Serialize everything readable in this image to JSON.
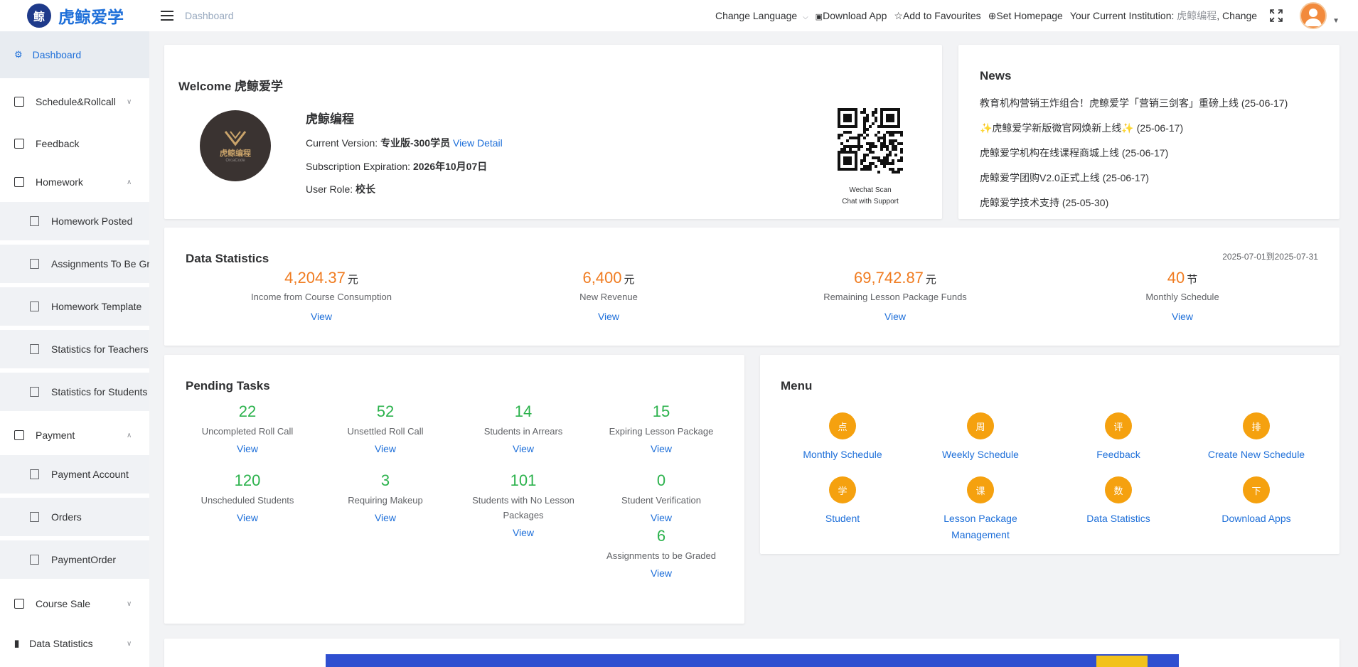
{
  "app": {
    "name": "虎鲸爱学",
    "logo_text": "鲸"
  },
  "header": {
    "breadcrumb": "Dashboard",
    "change_language": "Change Language",
    "download_app": "Download App",
    "add_favourites": "Add to Favourites",
    "set_homepage": "Set Homepage",
    "institution_label": "Your Current Institution:",
    "institution_name": "虎鲸编程",
    "change": ", Change"
  },
  "sidebar": {
    "dashboard": "Dashboard",
    "schedule": "Schedule&Rollcall",
    "feedback": "Feedback",
    "homework": "Homework",
    "homework_posted": "Homework Posted",
    "assignments": "Assignments To Be Graded",
    "homework_template": "Homework Template",
    "stats_teachers": "Statistics for Teachers",
    "stats_students": "Statistics for Students",
    "payment": "Payment",
    "payment_account": "Payment Account",
    "orders": "Orders",
    "payment_order": "PaymentOrder",
    "course_sale": "Course Sale",
    "data_statistics": "Data Statistics"
  },
  "welcome": {
    "title": "Welcome 虎鲸爱学",
    "org_name": "虎鲸编程",
    "logo_cn": "虎鲸编程",
    "logo_en": "OrcaCode",
    "version_label": "Current Version:",
    "version_value": "专业版-300学员",
    "view_detail": "View Detail",
    "expiry_label": "Subscription Expiration:",
    "expiry_value": "2026年10月07日",
    "role_label": "User Role:",
    "role_value": "校长",
    "qr_line1": "Wechat Scan",
    "qr_line2": "Chat with Support"
  },
  "news": {
    "title": "News",
    "items": [
      "教育机构营销王炸组合！虎鲸爱学「营销三剑客」重磅上线 (25-06-17)",
      "✨虎鲸爱学新版微官网焕新上线✨ (25-06-17)",
      "虎鲸爱学机构在线课程商城上线 (25-06-17)",
      "虎鲸爱学团购V2.0正式上线 (25-06-17)",
      "虎鲸爱学技术支持 (25-05-30)"
    ]
  },
  "stats": {
    "title": "Data Statistics",
    "range": "2025-07-01到2025-07-31",
    "view": "View",
    "items": [
      {
        "value": "4,204.37",
        "unit": "元",
        "label": "Income from Course Consumption"
      },
      {
        "value": "6,400",
        "unit": "元",
        "label": "New Revenue"
      },
      {
        "value": "69,742.87",
        "unit": "元",
        "label": "Remaining Lesson Package Funds"
      },
      {
        "value": "40",
        "unit": "节",
        "label": "Monthly Schedule"
      }
    ]
  },
  "tasks": {
    "title": "Pending Tasks",
    "view": "View",
    "items": [
      {
        "value": "22",
        "label": "Uncompleted Roll Call"
      },
      {
        "value": "52",
        "label": "Unsettled Roll Call"
      },
      {
        "value": "14",
        "label": "Students in Arrears"
      },
      {
        "value": "15",
        "label": "Expiring Lesson Package"
      },
      {
        "value": "120",
        "label": "Unscheduled Students"
      },
      {
        "value": "3",
        "label": "Requiring Makeup"
      },
      {
        "value": "101",
        "label": "Students with No Lesson Packages"
      },
      {
        "value": "0",
        "label": "Student Verification"
      },
      {
        "value": "6",
        "label": "Assignments to be Graded"
      }
    ]
  },
  "menu": {
    "title": "Menu",
    "items": [
      {
        "glyph": "点",
        "label": "Monthly Schedule"
      },
      {
        "glyph": "周",
        "label": "Weekly Schedule"
      },
      {
        "glyph": "评",
        "label": "Feedback"
      },
      {
        "glyph": "排",
        "label": "Create New Schedule"
      },
      {
        "glyph": "学",
        "label": "Student"
      },
      {
        "glyph": "课",
        "label": "Lesson Package Management"
      },
      {
        "glyph": "数",
        "label": "Data Statistics"
      },
      {
        "glyph": "下",
        "label": "Download Apps"
      }
    ]
  },
  "colors": {
    "accent": "#1e6fd9",
    "orange": "#f07c21",
    "green": "#2bb24c",
    "menu_circle": "#f5a10f"
  }
}
